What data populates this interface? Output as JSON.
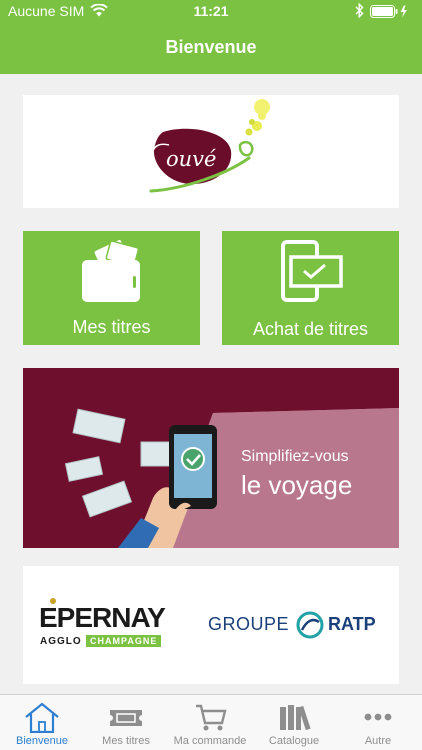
{
  "status_bar": {
    "carrier": "Aucune SIM",
    "time": "11:21"
  },
  "header": {
    "title": "Bienvenue"
  },
  "logo": {
    "brand_text": "Mouvéo"
  },
  "tiles": [
    {
      "label": "Mes titres",
      "icon": "wallet-icon"
    },
    {
      "label": "Achat de titres",
      "icon": "phone-ticket-check-icon"
    }
  ],
  "promo": {
    "line1": "Simplifiez-vous",
    "line2": "le voyage"
  },
  "partners": {
    "epernay_main": "EPERNAY",
    "epernay_sub1": "AGGLO",
    "epernay_sub2": "CHAMPAGNE",
    "ratp_left": "GROUPE",
    "ratp_right": "RATP"
  },
  "tabbar": {
    "active_index": 0,
    "items": [
      {
        "label": "Bienvenue",
        "icon": "home-icon"
      },
      {
        "label": "Mes titres",
        "icon": "ticket-icon"
      },
      {
        "label": "Ma commande",
        "icon": "cart-icon"
      },
      {
        "label": "Catalogue",
        "icon": "books-icon"
      },
      {
        "label": "Autre",
        "icon": "more-icon"
      }
    ]
  },
  "colors": {
    "brand_green": "#7cc242",
    "promo_burgundy": "#6f0f2e",
    "tab_active": "#2d7fd1",
    "tab_inactive": "#8e8e8e"
  }
}
